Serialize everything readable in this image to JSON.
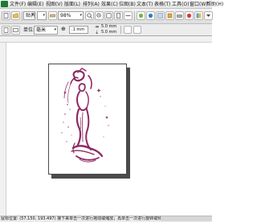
{
  "menubar": {
    "items": [
      {
        "label": "文件(F)"
      },
      {
        "label": "编辑(E)"
      },
      {
        "label": "视图(V)"
      },
      {
        "label": "版面(L)"
      },
      {
        "label": "排列(A)"
      },
      {
        "label": "效果(C)"
      },
      {
        "label": "位图(B)"
      },
      {
        "label": "文本(T)"
      },
      {
        "label": "表格(T)"
      },
      {
        "label": "工具(O)"
      },
      {
        "label": "窗口(W)"
      },
      {
        "label": "帮助(H)"
      }
    ]
  },
  "toolbar": {
    "snap_label": "贴齐",
    "zoom_value": "98%"
  },
  "property_bar": {
    "units_label": "单位:",
    "units_value": "毫米",
    "nudge_value": ".1 mm",
    "duplicate_x": "5.0 mm",
    "duplicate_y": "5.0 mm"
  },
  "statusbar": {
    "text": "鼠标位置: (57.150, 193.497) 接下来单击一次进行拖动或缩放；再单击一次进行旋转或倾斜"
  },
  "colors": {
    "artwork": "#8e2a63",
    "app_icon": "#1c7a34"
  },
  "artwork": {
    "description_icon": "woman-with-water-jug-drawing"
  }
}
